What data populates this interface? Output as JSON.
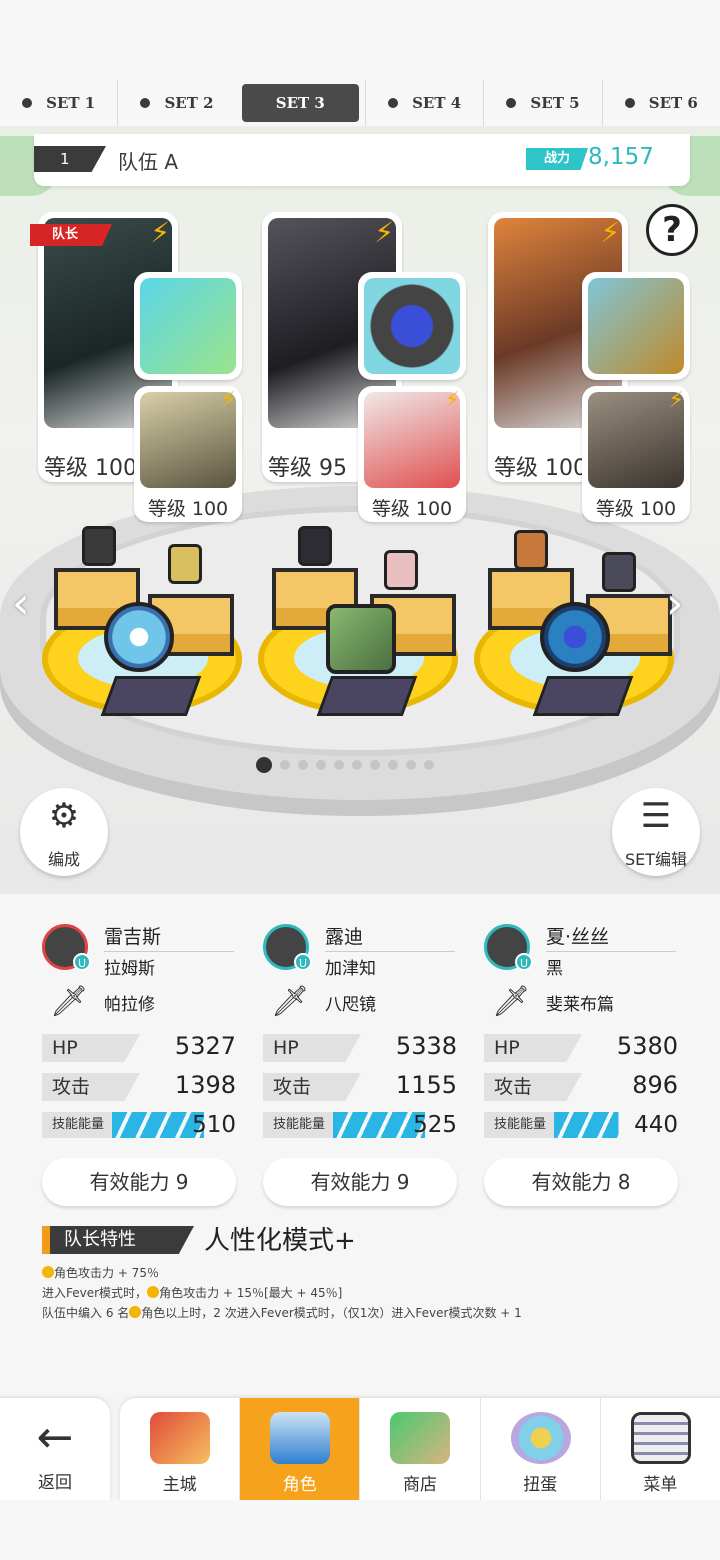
{
  "set_tabs": [
    {
      "label": "SET 1"
    },
    {
      "label": "SET 2"
    },
    {
      "label": "SET 3"
    },
    {
      "label": "SET 4"
    },
    {
      "label": "SET 5"
    },
    {
      "label": "SET 6"
    }
  ],
  "team": {
    "number": "1",
    "name": "队伍 A",
    "power_label": "战力",
    "power_value": "8,157"
  },
  "help": "?",
  "leader_tag": "队长",
  "cards": [
    {
      "level": "等级 100",
      "sub_level": "等级 100",
      "portrait_color": "#2b3a3a",
      "equip_color": "#4fc7d9",
      "sub_color": "#b8b08a"
    },
    {
      "level": "等级 95",
      "sub_level": "等级 100",
      "portrait_color": "#2d2b33",
      "equip_color": "#4aa8c8",
      "sub_color": "#e04848"
    },
    {
      "level": "等级 100",
      "sub_level": "等级 100",
      "portrait_color": "#c8783a",
      "equip_color": "#5aa0b8",
      "sub_color": "#6a6155"
    }
  ],
  "pager": {
    "total": 10,
    "current": 0
  },
  "formation_button": {
    "label": "编成",
    "icon": "person-gear-icon"
  },
  "set_edit_button": {
    "label": "SET编辑",
    "icon": "list-icon"
  },
  "characters": [
    {
      "name": "雷吉斯",
      "equip": "拉姆斯",
      "sub": "帕拉修",
      "hp_label": "HP",
      "hp": "5327",
      "atk_label": "攻击",
      "atk": "1398",
      "energy_label": "技能能量",
      "energy": "510",
      "energy_fill": 1.0,
      "ability": "有效能力 9"
    },
    {
      "name": "露迪",
      "equip": "加津知",
      "sub": "八咫镜",
      "hp_label": "HP",
      "hp": "5338",
      "atk_label": "攻击",
      "atk": "1155",
      "energy_label": "技能能量",
      "energy": "525",
      "energy_fill": 1.0,
      "ability": "有效能力 9"
    },
    {
      "name": "夏·丝丝",
      "equip": "黑",
      "sub": "斐莱布篇",
      "hp_label": "HP",
      "hp": "5380",
      "atk_label": "攻击",
      "atk": "896",
      "energy_label": "技能能量",
      "energy": "440",
      "energy_fill": 0.7,
      "ability": "有效能力 8"
    }
  ],
  "leader_trait": {
    "tag": "队长特性",
    "name": "人性化模式+",
    "line1": "角色攻击力 + 75％",
    "line2a": "进入Fever模式时，",
    "line2b": "角色攻击力 + 15％[最大 + 45％]",
    "line3a": "队伍中编入 6 名",
    "line3b": "角色以上时，2 次进入Fever模式时，（仅1次）进入Fever模式次数 + 1"
  },
  "nav": {
    "back": "返回",
    "items": [
      {
        "label": "主城"
      },
      {
        "label": "角色"
      },
      {
        "label": "商店"
      },
      {
        "label": "扭蛋"
      },
      {
        "label": "菜单"
      }
    ],
    "active_index": 1
  },
  "colors": {
    "accent": "#2fb9bd",
    "nav_active": "#f7a21c",
    "leader": "#d72525",
    "bolt": "#f5b400"
  }
}
